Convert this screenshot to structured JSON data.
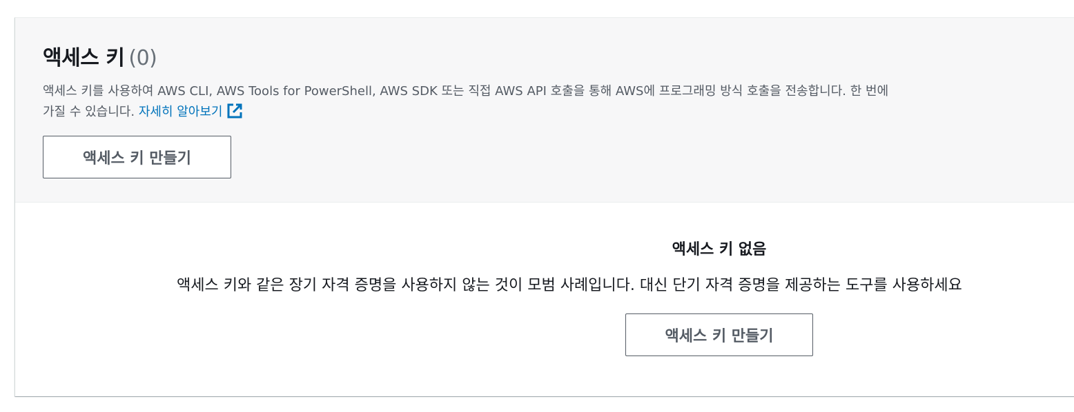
{
  "header": {
    "title": "액세스 키",
    "count": "(0)",
    "description_line1": "액세스 키를 사용하여 AWS CLI, AWS Tools for PowerShell, AWS SDK 또는 직접 AWS API 호출을 통해 AWS에 프로그래밍 방식 호출을 전송합니다. 한 번에",
    "description_line2": "가질 수 있습니다.",
    "learn_more_label": "자세히 알아보기",
    "learn_more_icon": "external-link-icon",
    "create_button_label": "액세스 키 만들기"
  },
  "empty_state": {
    "title": "액세스 키 없음",
    "description": "액세스 키와 같은 장기 자격 증명을 사용하지 않는 것이 모범 사례입니다. 대신 단기 자격 증명을 제공하는 도구를 사용하세요",
    "create_button_label": "액세스 키 만들기"
  },
  "colors": {
    "header_background": "#f7f7f8",
    "link": "#0073bb",
    "button_border": "#545b64",
    "muted_text": "#687078"
  }
}
